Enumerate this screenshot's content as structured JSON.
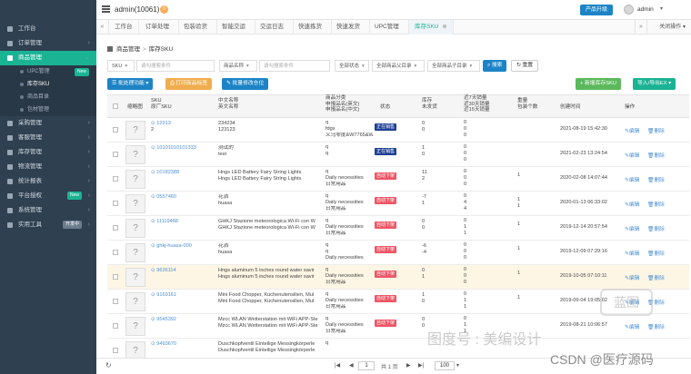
{
  "sidebar": {
    "items": [
      {
        "label": "工作台",
        "icon": "home-icon",
        "type": "item"
      },
      {
        "label": "订单管理",
        "icon": "order-icon",
        "type": "item",
        "chevron": "›"
      },
      {
        "label": "商品管理",
        "icon": "goods-icon",
        "type": "item",
        "chevron": "⌄",
        "active": true
      },
      {
        "label": "UPC管理",
        "type": "sub",
        "badge": "New"
      },
      {
        "label": "库存SKU",
        "type": "sub",
        "active": true
      },
      {
        "label": "商品目录",
        "type": "sub"
      },
      {
        "label": "包材管理",
        "type": "sub"
      },
      {
        "label": "采购管理",
        "icon": "cart-icon",
        "type": "item",
        "chevron": "›"
      },
      {
        "label": "客服管理",
        "icon": "service-icon",
        "type": "item",
        "chevron": "›"
      },
      {
        "label": "库存管理",
        "icon": "warehouse-icon",
        "type": "item",
        "chevron": "›"
      },
      {
        "label": "物流管理",
        "icon": "truck-icon",
        "type": "item",
        "chevron": "›"
      },
      {
        "label": "统计报表",
        "icon": "chart-icon",
        "type": "item",
        "chevron": "›"
      },
      {
        "label": "平台授权",
        "icon": "key-icon",
        "type": "item",
        "badge": "New",
        "chevron": "›"
      },
      {
        "label": "系统管理",
        "icon": "gear-icon",
        "type": "item",
        "chevron": "›"
      },
      {
        "label": "实用工具",
        "icon": "tool-icon",
        "type": "item",
        "badge": "开发中",
        "chevron": "›"
      }
    ]
  },
  "header": {
    "user_title": "admin(10061)",
    "message_count": "0",
    "upgrade_label": "产品升级",
    "user_name": "admin"
  },
  "tabs": {
    "items": [
      "工作台",
      "订单处理",
      "包装验货",
      "智能交运",
      "交运日志",
      "快速拣货",
      "快速发货",
      "UPC管理",
      "库存SKU"
    ],
    "active": "库存SKU",
    "close_label": "关闭操作"
  },
  "breadcrumb": {
    "root": "商品管理",
    "current": "库存SKU"
  },
  "filters": {
    "sku_select": "SKU",
    "sku_placeholder": "请勾搜索条件",
    "name_select": "商品名称",
    "name_placeholder": "请勾搜索条件",
    "status_select": "全部状态",
    "category_select": "全部商品父目录",
    "subcategory_select": "全部商品子目录",
    "search_label": "搜索",
    "reset_label": "重置"
  },
  "actions": {
    "bulk_label": "批处理功能",
    "print_label": "打印商品标签",
    "edit_label": "批量修改仓位",
    "add_label": "+ 新增库存SKU",
    "import_label": "导入/导出EX"
  },
  "table": {
    "headers": {
      "thumb": "缩略图",
      "sku": [
        "SKU",
        "原厂SKU"
      ],
      "name": [
        "中文名称",
        "英文名称"
      ],
      "category": [
        "商品分类",
        "申报品名(英文)",
        "申报品名(中文)"
      ],
      "status": "状态",
      "stock": [
        "库存",
        "未发货"
      ],
      "sales": [
        "近7天销量",
        "近30天销量",
        "近15天销量"
      ],
      "weight": [
        "重量",
        "包装个数"
      ],
      "created": "创建时间",
      "ops": "操作"
    },
    "edit_label": "编辑",
    "delete_label": "删除",
    "rows": [
      {
        "sku": "12313",
        "sku2": "2",
        "cn": "234234",
        "en": "123123",
        "cat": "q",
        "cat2": "fdgs",
        "cat3": "义乌零度&W7765&W",
        "status": "正在销售",
        "status_type": "on",
        "stock": "0",
        "stock2": "0",
        "s7": "0",
        "s30": "0",
        "s15": "0",
        "w": "",
        "w2": "",
        "created": "2021-08-19 15:42:30"
      },
      {
        "sku": "10101010101333",
        "sku2": "",
        "cn": "测试的",
        "en": "test",
        "cat": "q",
        "cat2": "q",
        "cat3": "",
        "status": "正在销售",
        "status_type": "on",
        "stock": "1",
        "stock2": "0",
        "s7": "0",
        "s30": "0",
        "s15": "0",
        "w": "",
        "w2": "",
        "created": "2021-02-23 13:24:54"
      },
      {
        "sku": "10182388",
        "sku2": "",
        "cn": "Hngs LED Battery Fairy String Lights",
        "en": "Hngs LED Battery Fairy String Lights",
        "cat": "q",
        "cat2": "Daily necessities",
        "cat3": "日常用品",
        "status": "自动下架",
        "status_type": "off",
        "stock": "11",
        "stock2": "2",
        "s7": "0",
        "s30": "0",
        "s15": "0",
        "w": "1",
        "w2": "",
        "created": "2020-02-08 14:07:44"
      },
      {
        "sku": "0557460",
        "sku2": "",
        "cn": "花洒",
        "en": "huasa",
        "cat": "q",
        "cat2": "Daily necessities",
        "cat3": "日常用品",
        "status": "自动下架",
        "status_type": "off",
        "stock": "-7",
        "stock2": "1",
        "s7": "0",
        "s30": "4",
        "s15": "4",
        "w": "1",
        "w2": "1",
        "created": "2020-01-13 06:33:02"
      },
      {
        "sku": "11119488",
        "sku2": "",
        "cn": "GHKJ Stazione meteorologica Wi-Fi con W",
        "en": "GHKJ Stazione meteorologica Wi-Fi con W",
        "cat": "q",
        "cat2": "Daily necessities",
        "cat3": "日常用品",
        "status": "自动下架",
        "status_type": "off",
        "stock": "0",
        "stock2": "0",
        "s7": "0",
        "s30": "1",
        "s15": "1",
        "w": "1",
        "w2": "",
        "created": "2019-12-14 20:57:54"
      },
      {
        "sku": "ghkj-huasa-000",
        "sku2": "",
        "cn": "花洒",
        "en": "huasa",
        "cat": "q",
        "cat2": "q",
        "cat3": "Daily necessities",
        "status": "自动下架",
        "status_type": "off",
        "stock": "-6",
        "stock2": "-4",
        "s7": "0",
        "s30": "0",
        "s15": "0",
        "w": "1",
        "w2": "",
        "created": "2019-12-09 07:29:16"
      },
      {
        "sku": "9636114",
        "sku2": "",
        "cn": "Hngs aluminum 5 inches round water savir",
        "en": "Hngs aluminum 5 inches round water savir",
        "cat": "q",
        "cat2": "Daily necessities",
        "cat3": "日常用品",
        "status": "自动下架",
        "status_type": "off",
        "stock": "0",
        "stock2": "1",
        "s7": "0",
        "s30": "0",
        "s15": "0",
        "w": "1",
        "w2": "",
        "created": "2019-10-05 07:10:11"
      },
      {
        "sku": "9169161",
        "sku2": "",
        "cn": "Mini Food Chopper, Küchenutensilien, Mul",
        "en": "Mini Food Chopper, Küchenutensilien, Mul",
        "cat": "q",
        "cat2": "Daily necessities",
        "cat3": "日常用品",
        "status": "自动下架",
        "status_type": "off",
        "stock": "1",
        "stock2": "0",
        "s7": "0",
        "s30": "1",
        "s15": "1",
        "w": "1",
        "w2": "",
        "created": "2019-09-04 19:05:02"
      },
      {
        "sku": "9545392",
        "sku2": "",
        "cn": "Mzcc WLAN Wetterstation mit WiFi APP-Ste",
        "en": "Mzcc WLAN Wetterstation mit WiFi APP-Ste",
        "cat": "q",
        "cat2": "Daily necessities",
        "cat3": "日常用品",
        "status": "自动下架",
        "status_type": "off",
        "stock": "0",
        "stock2": "0",
        "s7": "0",
        "s30": "1",
        "s15": "1",
        "w": "",
        "w2": "",
        "created": "2019-08-21 10:06:57"
      },
      {
        "sku": "9493670",
        "sku2": "",
        "cn": "Duschkopfventil Einteilige Messingkörperle",
        "en": "Duschkopfventil Einteilige Messingkörperle",
        "cat": "q",
        "cat2": "",
        "cat3": "",
        "status": "",
        "status_type": "off",
        "stock": "",
        "stock2": "",
        "s7": "",
        "s30": "",
        "s15": "",
        "w": "",
        "w2": "",
        "created": ""
      }
    ]
  },
  "footer": {
    "page": "1",
    "total_pages": "共 1 页",
    "per_page": "100"
  },
  "watermark": {
    "text1": "CSDN @医疗源码",
    "text2": "图度号 : 美编设计",
    "text3": "蓝图"
  },
  "colors": {
    "sidebar": "#2f4050",
    "accent": "#1ab394",
    "primary": "#1c84c6",
    "danger": "#ed5565"
  }
}
